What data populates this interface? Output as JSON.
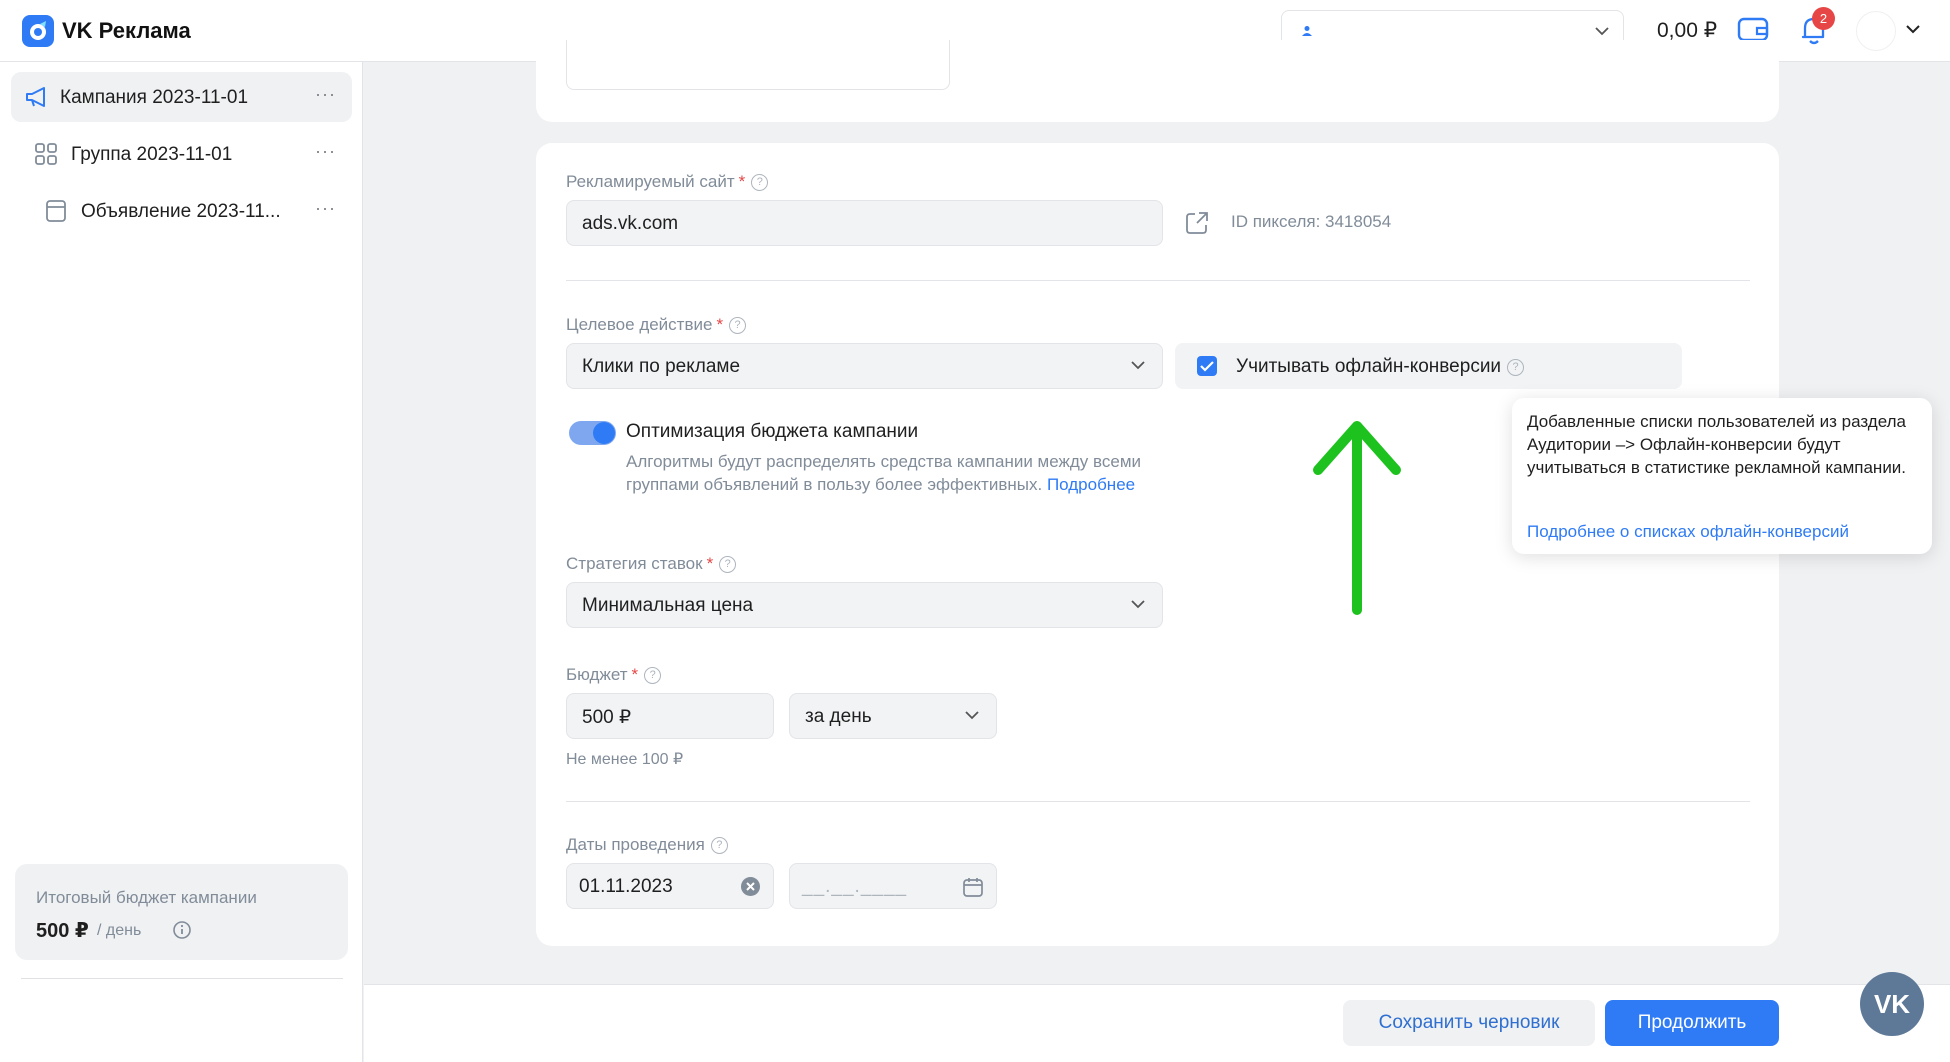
{
  "header": {
    "brand": "VK Реклама",
    "account_select_value": "",
    "balance": "0,00 ₽",
    "notifications_count": "2"
  },
  "sidebar": {
    "items": [
      {
        "label": "Кампания 2023-11-01",
        "icon": "megaphone-icon",
        "active": true
      },
      {
        "label": "Группа 2023-11-01",
        "icon": "grid-icon",
        "active": false
      },
      {
        "label": "Объявление 2023-11...",
        "icon": "ad-card-icon",
        "active": false
      }
    ],
    "more_label": "···",
    "budget": {
      "label": "Итоговый бюджет кампании",
      "value": "500 ₽",
      "unit": "/ день"
    }
  },
  "form": {
    "site": {
      "label": "Рекламируемый сайт",
      "required": "*",
      "value": "ads.vk.com",
      "pixel_id": "ID пикселя: 3418054"
    },
    "target_action": {
      "label": "Целевое действие",
      "required": "*",
      "value": "Клики по рекламе"
    },
    "offline_conversions": {
      "label": "Учитывать офлайн-конверсии",
      "checked": true
    },
    "budget_optimization": {
      "title": "Оптимизация бюджета кампании",
      "description": "Алгоритмы будут распределять средства кампании между всеми группами объявлений в пользу более эффективных.",
      "link": "Подробнее",
      "enabled": true
    },
    "bid_strategy": {
      "label": "Стратегия ставок",
      "required": "*",
      "value": "Минимальная цена"
    },
    "budget": {
      "label": "Бюджет",
      "required": "*",
      "value": "500 ₽",
      "period": "за день",
      "hint": "Не менее 100 ₽"
    },
    "dates": {
      "label": "Даты проведения",
      "start": "01.11.2023",
      "end_placeholder": "__.__.____"
    }
  },
  "tooltip": {
    "text": "Добавленные списки пользователей из раздела Аудитории –> Офлайн-конверсии будут учитываться в статистике рекламной кампании.",
    "link": "Подробнее о списках офлайн-конверсий"
  },
  "footer": {
    "save_draft": "Сохранить черновик",
    "continue": "Продолжить"
  },
  "help_fab": "VK",
  "colors": {
    "accent": "#2f7bf5",
    "annotation_arrow": "#1ec21e",
    "required": "#e64646"
  }
}
